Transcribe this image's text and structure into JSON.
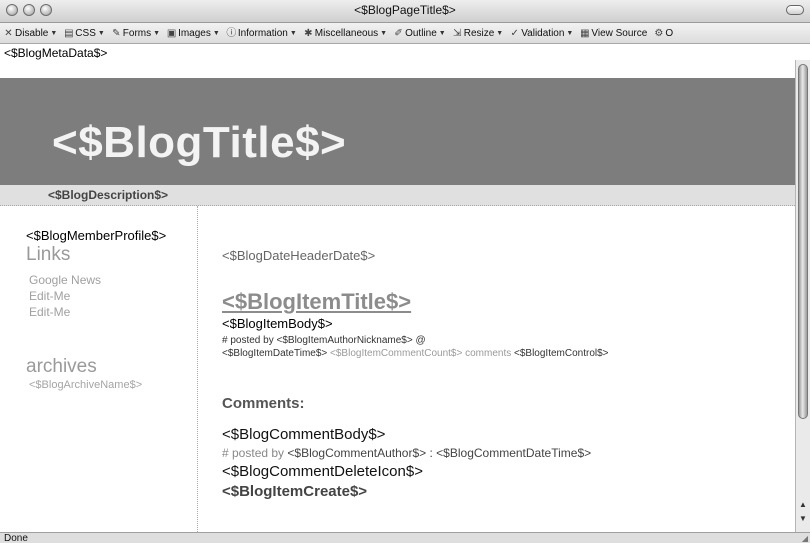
{
  "window": {
    "title": "<$BlogPageTitle$>"
  },
  "toolbar": {
    "items": [
      {
        "label": "Disable",
        "icon": "x-icon"
      },
      {
        "label": "CSS",
        "icon": "css-icon"
      },
      {
        "label": "Forms",
        "icon": "forms-icon"
      },
      {
        "label": "Images",
        "icon": "images-icon"
      },
      {
        "label": "Information",
        "icon": "info-icon"
      },
      {
        "label": "Miscellaneous",
        "icon": "misc-icon"
      },
      {
        "label": "Outline",
        "icon": "outline-icon"
      },
      {
        "label": "Resize",
        "icon": "resize-icon"
      },
      {
        "label": "Validation",
        "icon": "validation-icon"
      },
      {
        "label": "View Source",
        "icon": "view-source-icon"
      },
      {
        "label": "O",
        "icon": "options-icon"
      }
    ]
  },
  "page": {
    "meta_data": "<$BlogMetaData$>",
    "blog_title": "<$BlogTitle$>",
    "blog_description": "<$BlogDescription$>",
    "sidebar": {
      "member_profile": "<$BlogMemberProfile$>",
      "links_heading": "Links",
      "links": [
        "Google News",
        "Edit-Me",
        "Edit-Me"
      ],
      "archives_heading": "archives",
      "archive_name": "<$BlogArchiveName$>"
    },
    "post": {
      "date_header": "<$BlogDateHeaderDate$>",
      "item_title": "<$BlogItemTitle$>",
      "item_body": "<$BlogItemBody$>",
      "posted_prefix": "# posted by",
      "author_nickname": "<$BlogItemAuthorNickname$>",
      "at": "@",
      "item_datetime": "<$BlogItemDateTime$>",
      "comment_count": "<$BlogItemCommentCount$>",
      "comments_word": "comments",
      "item_control": "<$BlogItemControl$>"
    },
    "comments": {
      "heading": "Comments:",
      "body": "<$BlogCommentBody$>",
      "posted_prefix": "# posted by",
      "author": "<$BlogCommentAuthor$>",
      "separator": ":",
      "datetime": "<$BlogCommentDateTime$>",
      "delete_icon": "<$BlogCommentDeleteIcon$>",
      "item_create": "<$BlogItemCreate$>"
    }
  },
  "status": {
    "text": "Done"
  },
  "colors": {
    "header_bg": "#7d7d7d",
    "desc_bar_bg": "#e0e0e0",
    "link_gray": "#a0a0a0"
  }
}
